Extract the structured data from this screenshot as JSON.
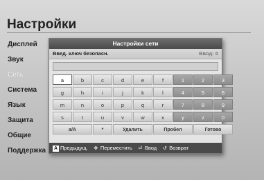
{
  "page": {
    "title": "Настройки"
  },
  "menu": {
    "items": [
      {
        "label": "Дисплей"
      },
      {
        "label": "Звук"
      },
      {
        "label": "Сеть"
      },
      {
        "label": "Система"
      },
      {
        "label": "Язык"
      },
      {
        "label": "Защита"
      },
      {
        "label": "Общие"
      },
      {
        "label": "Поддержка"
      }
    ]
  },
  "dialog": {
    "title": "Настройки сети",
    "key_label": "Введ. ключ безопасн.",
    "key_count": "Ввод: 0",
    "input_value": ""
  },
  "keyboard": {
    "rows": [
      [
        "a",
        "b",
        "c",
        "d",
        "e",
        "f",
        "1",
        "2",
        "3"
      ],
      [
        "g",
        "h",
        "i",
        "j",
        "k",
        "l",
        "4",
        "5",
        "6"
      ],
      [
        "m",
        "n",
        "o",
        "p",
        "q",
        "r",
        "7",
        "8",
        "9"
      ],
      [
        "s",
        "t",
        "u",
        "v",
        "w",
        "x",
        "y",
        "z",
        "0"
      ]
    ],
    "bottom": {
      "case_toggle": "a/A",
      "symbol": "*",
      "delete": "Удалить",
      "space": "Пробел",
      "done": "Готово"
    }
  },
  "footer": {
    "prev_icon": "A",
    "prev_label": "Предыдущ.",
    "move_icon": "move-arrows-icon",
    "move_label": "Переместить",
    "enter_icon": "enter-icon",
    "enter_label": "Ввод",
    "back_icon": "return-icon",
    "back_label": "Возврат"
  }
}
